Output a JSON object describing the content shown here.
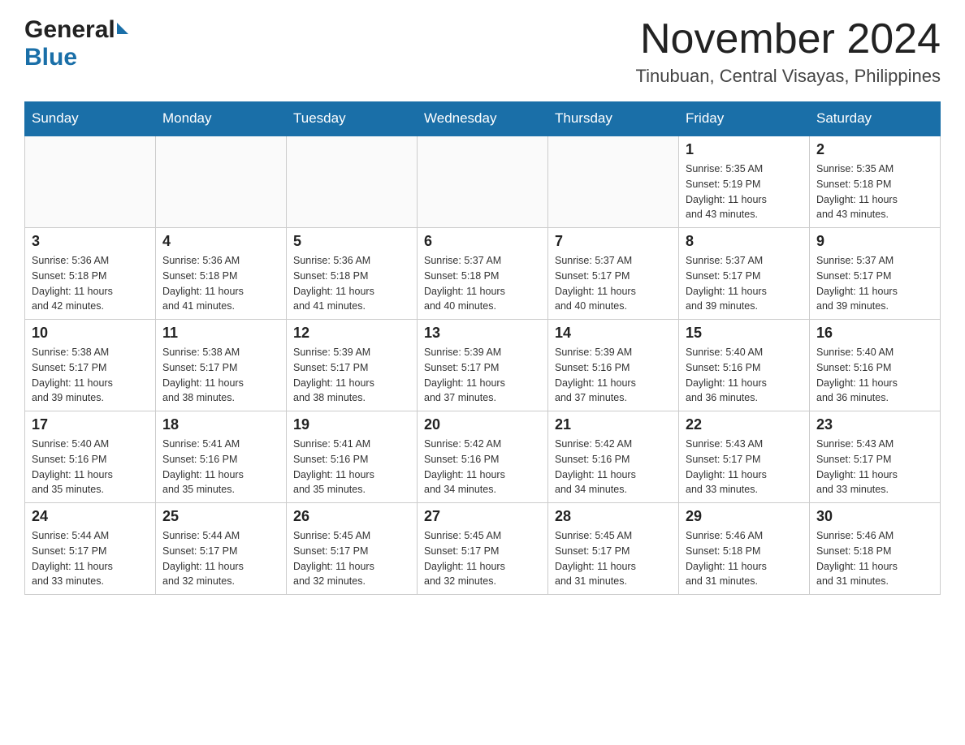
{
  "header": {
    "logo_general": "General",
    "logo_blue": "Blue",
    "month_title": "November 2024",
    "location": "Tinubuan, Central Visayas, Philippines"
  },
  "days_of_week": [
    "Sunday",
    "Monday",
    "Tuesday",
    "Wednesday",
    "Thursday",
    "Friday",
    "Saturday"
  ],
  "weeks": [
    [
      {
        "day": "",
        "info": ""
      },
      {
        "day": "",
        "info": ""
      },
      {
        "day": "",
        "info": ""
      },
      {
        "day": "",
        "info": ""
      },
      {
        "day": "",
        "info": ""
      },
      {
        "day": "1",
        "info": "Sunrise: 5:35 AM\nSunset: 5:19 PM\nDaylight: 11 hours\nand 43 minutes."
      },
      {
        "day": "2",
        "info": "Sunrise: 5:35 AM\nSunset: 5:18 PM\nDaylight: 11 hours\nand 43 minutes."
      }
    ],
    [
      {
        "day": "3",
        "info": "Sunrise: 5:36 AM\nSunset: 5:18 PM\nDaylight: 11 hours\nand 42 minutes."
      },
      {
        "day": "4",
        "info": "Sunrise: 5:36 AM\nSunset: 5:18 PM\nDaylight: 11 hours\nand 41 minutes."
      },
      {
        "day": "5",
        "info": "Sunrise: 5:36 AM\nSunset: 5:18 PM\nDaylight: 11 hours\nand 41 minutes."
      },
      {
        "day": "6",
        "info": "Sunrise: 5:37 AM\nSunset: 5:18 PM\nDaylight: 11 hours\nand 40 minutes."
      },
      {
        "day": "7",
        "info": "Sunrise: 5:37 AM\nSunset: 5:17 PM\nDaylight: 11 hours\nand 40 minutes."
      },
      {
        "day": "8",
        "info": "Sunrise: 5:37 AM\nSunset: 5:17 PM\nDaylight: 11 hours\nand 39 minutes."
      },
      {
        "day": "9",
        "info": "Sunrise: 5:37 AM\nSunset: 5:17 PM\nDaylight: 11 hours\nand 39 minutes."
      }
    ],
    [
      {
        "day": "10",
        "info": "Sunrise: 5:38 AM\nSunset: 5:17 PM\nDaylight: 11 hours\nand 39 minutes."
      },
      {
        "day": "11",
        "info": "Sunrise: 5:38 AM\nSunset: 5:17 PM\nDaylight: 11 hours\nand 38 minutes."
      },
      {
        "day": "12",
        "info": "Sunrise: 5:39 AM\nSunset: 5:17 PM\nDaylight: 11 hours\nand 38 minutes."
      },
      {
        "day": "13",
        "info": "Sunrise: 5:39 AM\nSunset: 5:17 PM\nDaylight: 11 hours\nand 37 minutes."
      },
      {
        "day": "14",
        "info": "Sunrise: 5:39 AM\nSunset: 5:16 PM\nDaylight: 11 hours\nand 37 minutes."
      },
      {
        "day": "15",
        "info": "Sunrise: 5:40 AM\nSunset: 5:16 PM\nDaylight: 11 hours\nand 36 minutes."
      },
      {
        "day": "16",
        "info": "Sunrise: 5:40 AM\nSunset: 5:16 PM\nDaylight: 11 hours\nand 36 minutes."
      }
    ],
    [
      {
        "day": "17",
        "info": "Sunrise: 5:40 AM\nSunset: 5:16 PM\nDaylight: 11 hours\nand 35 minutes."
      },
      {
        "day": "18",
        "info": "Sunrise: 5:41 AM\nSunset: 5:16 PM\nDaylight: 11 hours\nand 35 minutes."
      },
      {
        "day": "19",
        "info": "Sunrise: 5:41 AM\nSunset: 5:16 PM\nDaylight: 11 hours\nand 35 minutes."
      },
      {
        "day": "20",
        "info": "Sunrise: 5:42 AM\nSunset: 5:16 PM\nDaylight: 11 hours\nand 34 minutes."
      },
      {
        "day": "21",
        "info": "Sunrise: 5:42 AM\nSunset: 5:16 PM\nDaylight: 11 hours\nand 34 minutes."
      },
      {
        "day": "22",
        "info": "Sunrise: 5:43 AM\nSunset: 5:17 PM\nDaylight: 11 hours\nand 33 minutes."
      },
      {
        "day": "23",
        "info": "Sunrise: 5:43 AM\nSunset: 5:17 PM\nDaylight: 11 hours\nand 33 minutes."
      }
    ],
    [
      {
        "day": "24",
        "info": "Sunrise: 5:44 AM\nSunset: 5:17 PM\nDaylight: 11 hours\nand 33 minutes."
      },
      {
        "day": "25",
        "info": "Sunrise: 5:44 AM\nSunset: 5:17 PM\nDaylight: 11 hours\nand 32 minutes."
      },
      {
        "day": "26",
        "info": "Sunrise: 5:45 AM\nSunset: 5:17 PM\nDaylight: 11 hours\nand 32 minutes."
      },
      {
        "day": "27",
        "info": "Sunrise: 5:45 AM\nSunset: 5:17 PM\nDaylight: 11 hours\nand 32 minutes."
      },
      {
        "day": "28",
        "info": "Sunrise: 5:45 AM\nSunset: 5:17 PM\nDaylight: 11 hours\nand 31 minutes."
      },
      {
        "day": "29",
        "info": "Sunrise: 5:46 AM\nSunset: 5:18 PM\nDaylight: 11 hours\nand 31 minutes."
      },
      {
        "day": "30",
        "info": "Sunrise: 5:46 AM\nSunset: 5:18 PM\nDaylight: 11 hours\nand 31 minutes."
      }
    ]
  ]
}
